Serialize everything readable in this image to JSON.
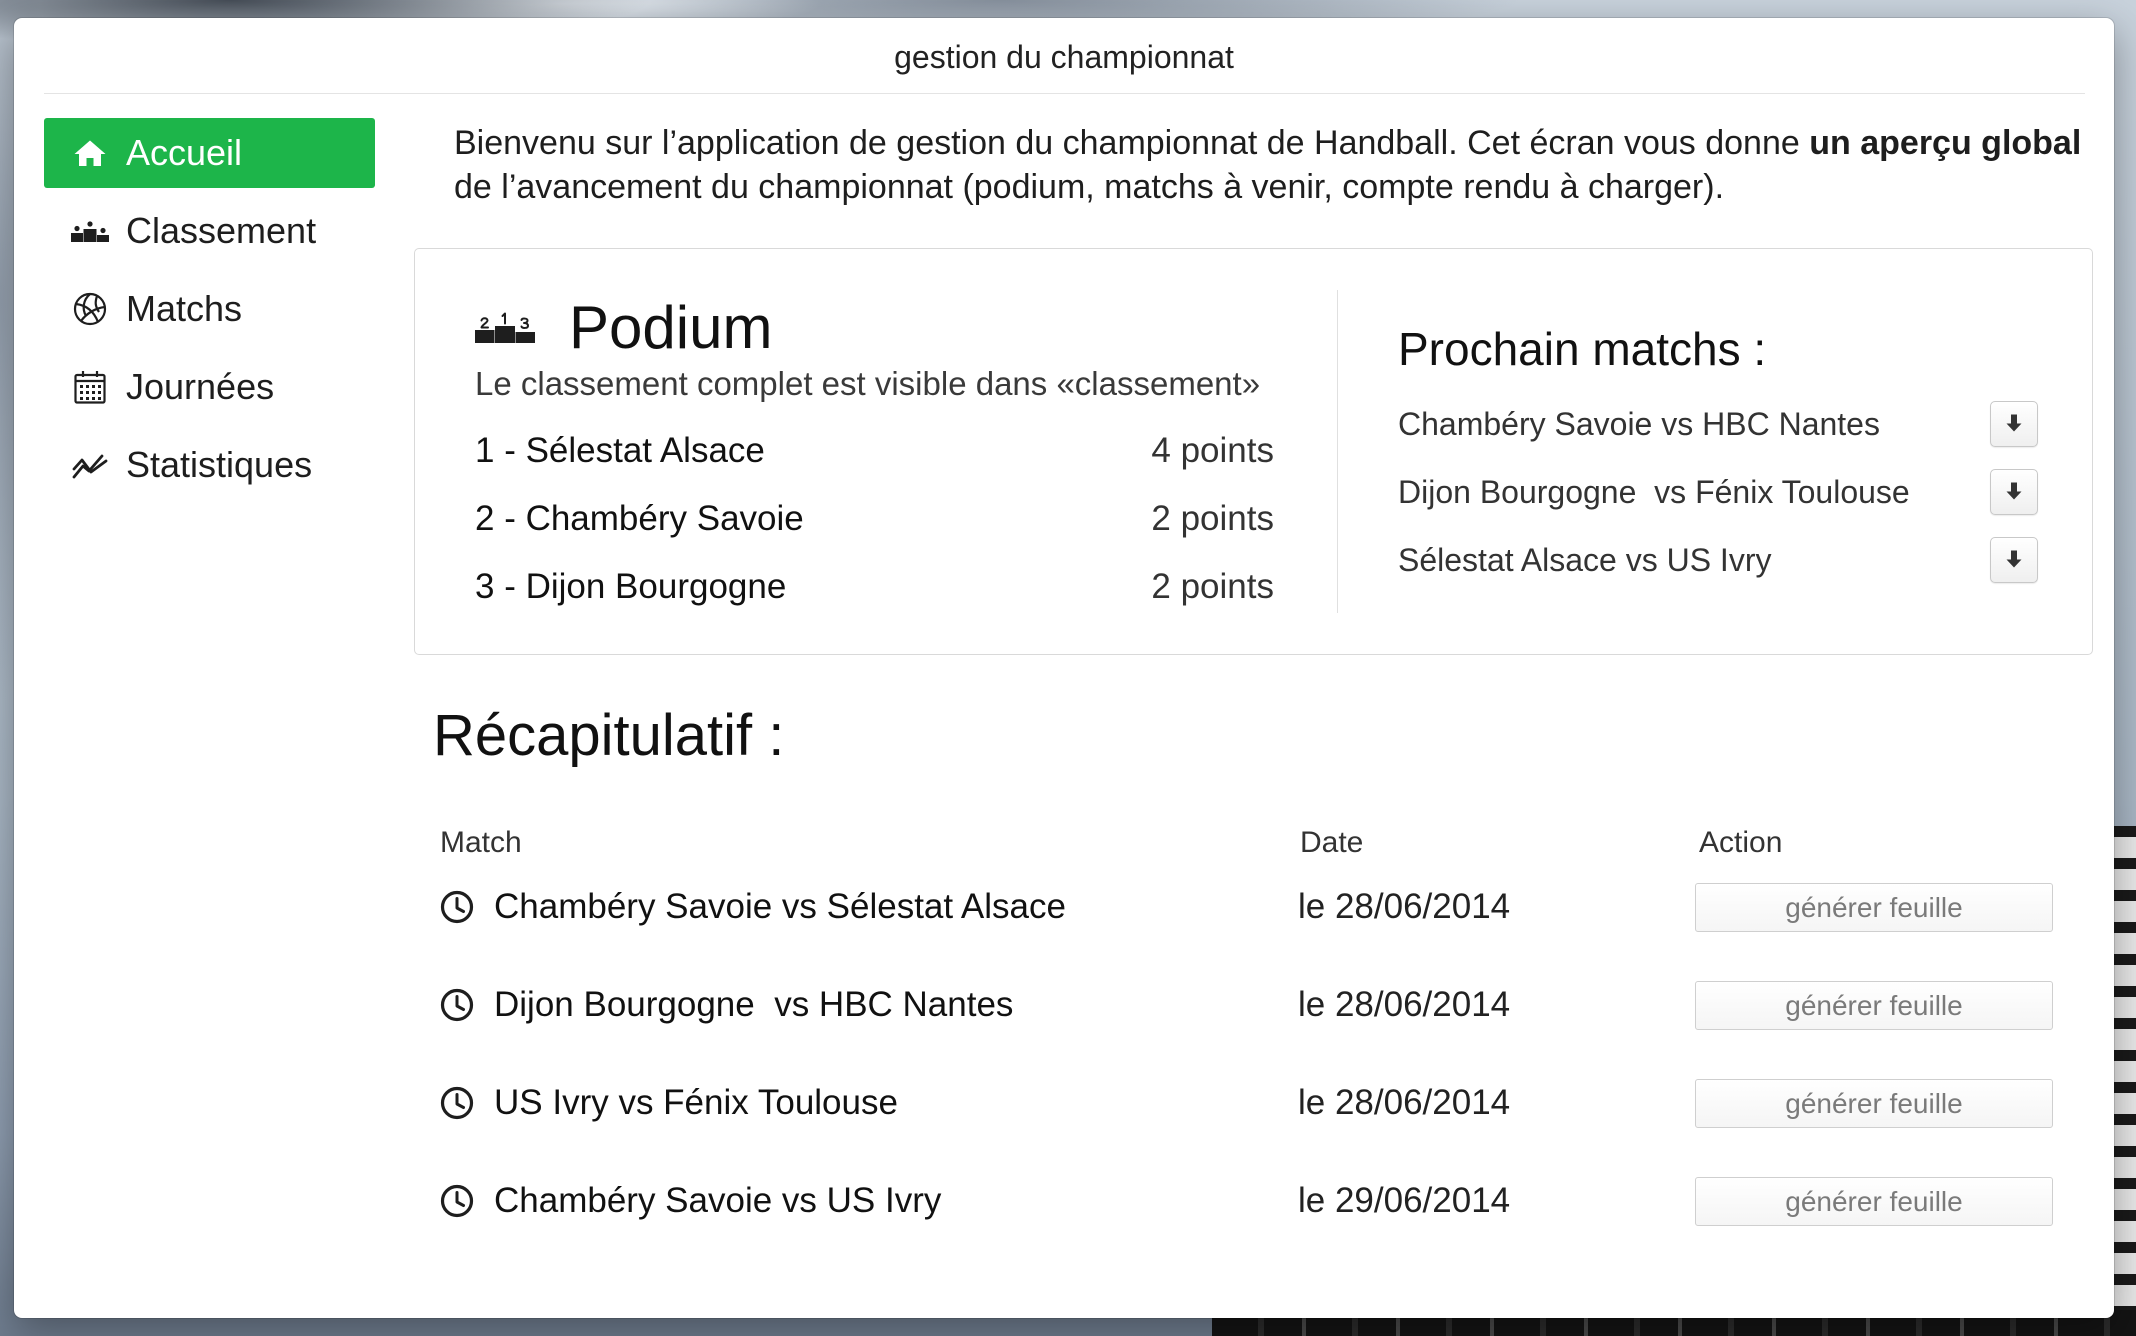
{
  "window": {
    "title": "gestion du championnat"
  },
  "colors": {
    "accent": "#1db54a"
  },
  "sidebar": {
    "items": [
      {
        "label": "Accueil",
        "icon": "home-icon",
        "active": true
      },
      {
        "label": "Classement",
        "icon": "podium-icon",
        "active": false
      },
      {
        "label": "Matchs",
        "icon": "volleyball-icon",
        "active": false
      },
      {
        "label": "Journées",
        "icon": "calendar-icon",
        "active": false
      },
      {
        "label": "Statistiques",
        "icon": "stats-icon",
        "active": false
      }
    ]
  },
  "intro": {
    "before": "Bienvenu sur l’application de gestion du championnat de Handball. Cet écran vous donne ",
    "emphasis": "un aperçu global",
    "after": " de l’avancement du championnat (podium, matchs à venir, compte rendu à charger)."
  },
  "podium": {
    "icon": "podium-icon",
    "title": "Podium",
    "subtitle": "Le classement complet est visible dans «classement»",
    "ranking": [
      {
        "label": "1 - Sélestat Alsace",
        "points": "4 points"
      },
      {
        "label": "2 - Chambéry Savoie",
        "points": "2 points"
      },
      {
        "label": "3 - Dijon Bourgogne",
        "points": "2 points"
      }
    ]
  },
  "next_matches": {
    "title": "Prochain matchs :",
    "items": [
      {
        "match": "Chambéry Savoie vs HBC Nantes",
        "icon": "download-icon"
      },
      {
        "match": "Dijon Bourgogne  vs Fénix Toulouse",
        "icon": "download-icon"
      },
      {
        "match": "Sélestat Alsace vs US Ivry",
        "icon": "download-icon"
      }
    ]
  },
  "recap": {
    "title": "Récapitulatif :",
    "columns": {
      "match": "Match",
      "date": "Date",
      "action": "Action"
    },
    "rows": [
      {
        "icon": "clock-icon",
        "match": "Chambéry Savoie vs Sélestat Alsace",
        "date": "le 28/06/2014",
        "action": "générer feuille"
      },
      {
        "icon": "clock-icon",
        "match": "Dijon Bourgogne  vs HBC Nantes",
        "date": "le 28/06/2014",
        "action": "générer feuille"
      },
      {
        "icon": "clock-icon",
        "match": "US Ivry vs Fénix Toulouse",
        "date": "le 28/06/2014",
        "action": "générer feuille"
      },
      {
        "icon": "clock-icon",
        "match": "Chambéry Savoie vs US Ivry",
        "date": "le 29/06/2014",
        "action": "générer feuille"
      }
    ]
  }
}
